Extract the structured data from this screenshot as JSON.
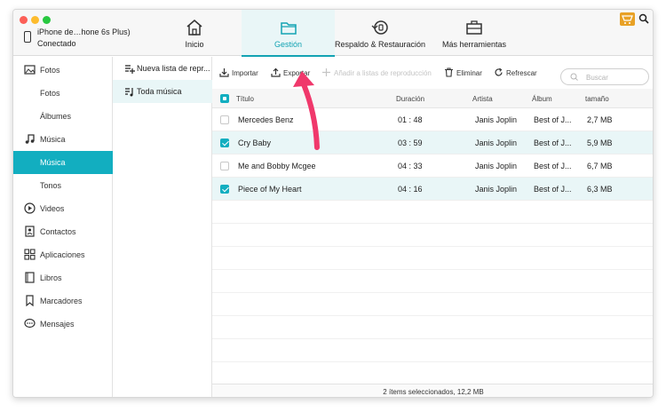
{
  "device": {
    "name": "iPhone de…hone 6s Plus)",
    "status": "Conectado"
  },
  "nav_tabs": [
    {
      "label": "Inicio",
      "icon": "home-icon"
    },
    {
      "label": "Gestión",
      "icon": "folder-icon",
      "active": true
    },
    {
      "label": "Respaldo & Restauración",
      "icon": "restore-icon"
    },
    {
      "label": "Más herramientas",
      "icon": "toolbox-icon"
    }
  ],
  "sidebar": {
    "items": [
      {
        "label": "Fotos",
        "icon": "photo-icon"
      },
      {
        "label": "Fotos"
      },
      {
        "label": "Álbumes"
      },
      {
        "label": "Música",
        "icon": "music-icon"
      },
      {
        "label": "Música",
        "active": true
      },
      {
        "label": "Tonos"
      },
      {
        "label": "Videos",
        "icon": "video-icon"
      },
      {
        "label": "Contactos",
        "icon": "contacts-icon"
      },
      {
        "label": "Aplicaciones",
        "icon": "apps-icon"
      },
      {
        "label": "Libros",
        "icon": "book-icon"
      },
      {
        "label": "Marcadores",
        "icon": "bookmark-icon"
      },
      {
        "label": "Mensajes",
        "icon": "message-icon"
      }
    ]
  },
  "subpanel": {
    "new_playlist": "Nueva lista de repr...",
    "all_music": "Toda música"
  },
  "toolbar": {
    "import": "Importar",
    "export": "Exportar",
    "add_playlist": "Añadir a listas de reproducción",
    "delete": "Eliminar",
    "refresh": "Refrescar",
    "search_placeholder": "Buscar"
  },
  "table": {
    "headers": {
      "title": "Título",
      "duration": "Duración",
      "artist": "Artista",
      "album": "Álbum",
      "size": "tamaño"
    },
    "rows": [
      {
        "title": "Mercedes Benz",
        "duration": "01 : 48",
        "artist": "Janis Joplin",
        "album": "Best of J...",
        "size": "2,7 MB",
        "checked": false
      },
      {
        "title": "Cry Baby",
        "duration": "03 : 59",
        "artist": "Janis Joplin",
        "album": "Best of J...",
        "size": "5,9 MB",
        "checked": true
      },
      {
        "title": "Me and Bobby Mcgee",
        "duration": "04 : 33",
        "artist": "Janis Joplin",
        "album": "Best of J...",
        "size": "6,7 MB",
        "checked": false
      },
      {
        "title": "Piece of My Heart",
        "duration": "04 : 16",
        "artist": "Janis Joplin",
        "album": "Best of J...",
        "size": "6,3 MB",
        "checked": true
      }
    ]
  },
  "footer": {
    "status": "2 ítems seleccionados, 12,2 MB"
  },
  "colors": {
    "accent": "#12aec0",
    "highlight": "#e9f6f7",
    "arrow": "#f0386b",
    "cart": "#e8a125"
  }
}
